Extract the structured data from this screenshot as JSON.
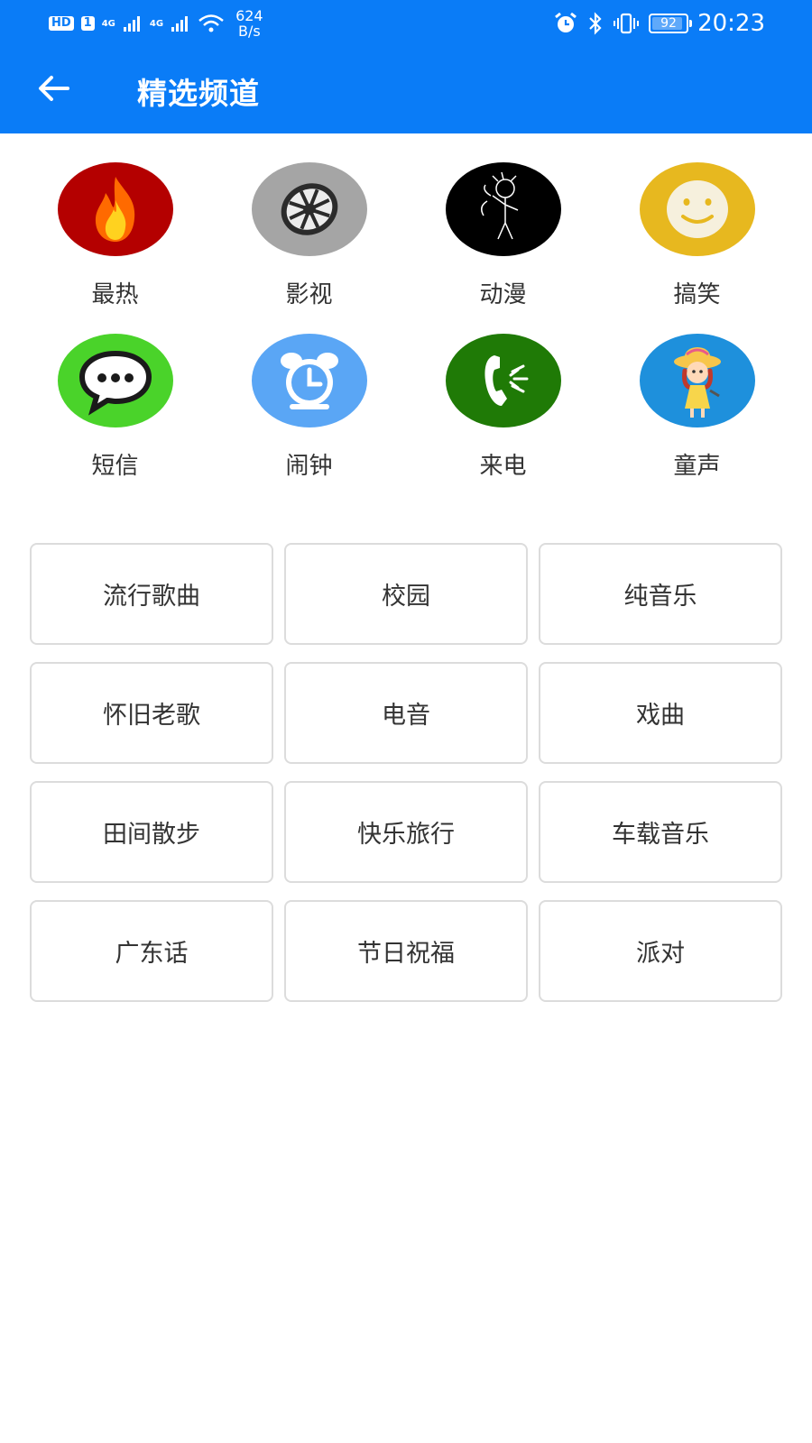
{
  "status_bar": {
    "sim_badge": "HD",
    "sim_slot": "1",
    "net1": "4G",
    "net2": "4G",
    "speed_value": "624",
    "speed_unit": "B/s",
    "battery": "92",
    "battery_level": 0.92,
    "time": "20:23",
    "icons": [
      "alarm-icon",
      "bluetooth-icon",
      "vibrate-icon",
      "battery-icon"
    ]
  },
  "app_bar": {
    "back_icon": "arrow-left-icon",
    "title": "精选频道"
  },
  "colors": {
    "primary": "#0a7cf7",
    "hot_bg": "#b40000",
    "video_bg": "#a5a5a5",
    "anime_bg": "#000000",
    "funny_bg": "#e7b81f",
    "sms_bg": "#4ad32a",
    "alarm_bg": "#5aa6f5",
    "call_bg": "#1f7a06",
    "kids_bg": "#1e90dc"
  },
  "categories": [
    {
      "label": "最热",
      "icon": "flame-icon"
    },
    {
      "label": "影视",
      "icon": "film-reel-icon"
    },
    {
      "label": "动漫",
      "icon": "anime-sketch-icon"
    },
    {
      "label": "搞笑",
      "icon": "smiley-icon"
    },
    {
      "label": "短信",
      "icon": "chat-bubble-icon"
    },
    {
      "label": "闹钟",
      "icon": "alarm-clock-icon"
    },
    {
      "label": "来电",
      "icon": "phone-ringing-icon"
    },
    {
      "label": "童声",
      "icon": "child-singer-icon"
    }
  ],
  "tags": [
    "流行歌曲",
    "校园",
    "纯音乐",
    "怀旧老歌",
    "电音",
    "戏曲",
    "田间散步",
    "快乐旅行",
    "车载音乐",
    "广东话",
    "节日祝福",
    "派对"
  ]
}
